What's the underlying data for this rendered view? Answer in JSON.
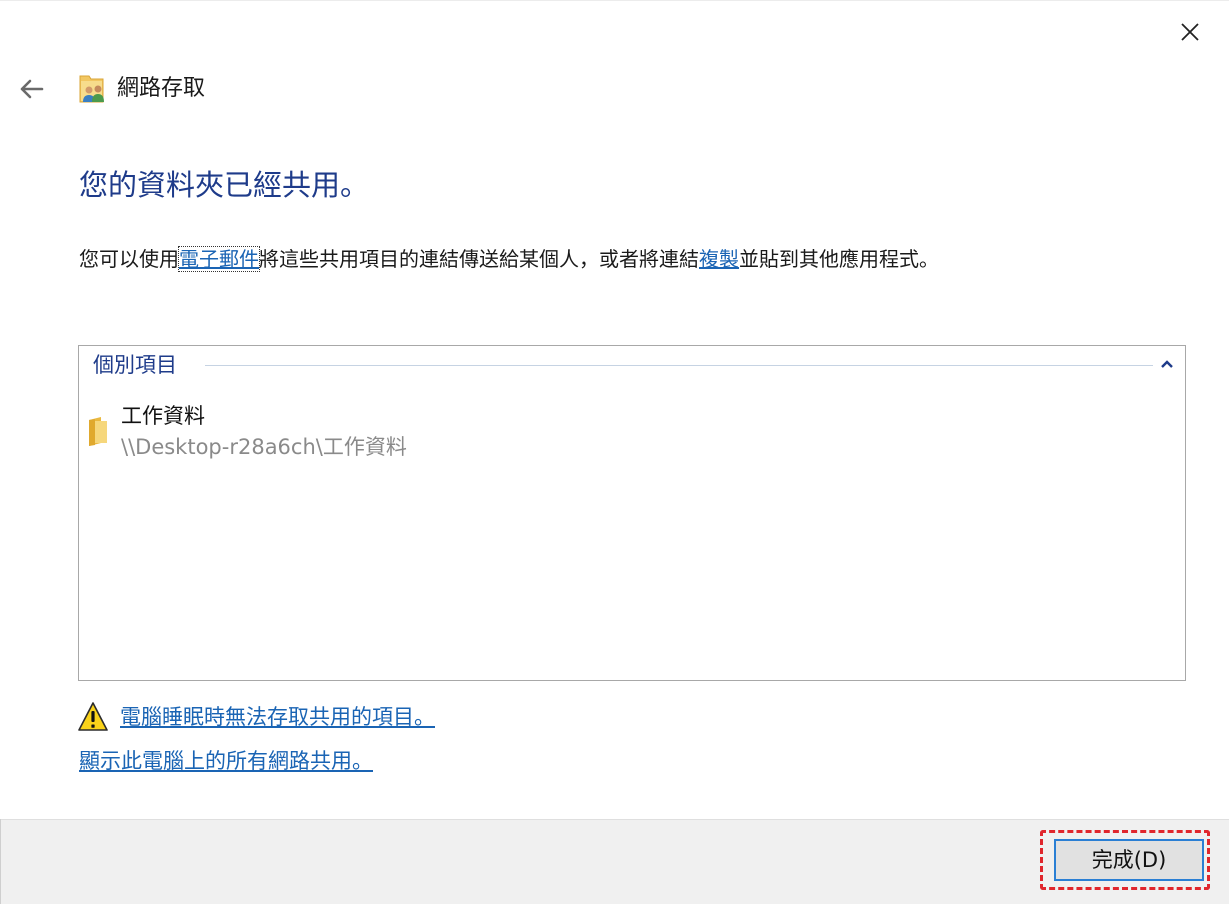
{
  "window": {
    "title": "網路存取",
    "icon": "network-share-users-icon"
  },
  "main": {
    "heading": "您的資料夾已經共用。",
    "description": {
      "before": "您可以使用",
      "email_link": "電子郵件",
      "middle": "將這些共用項目的連結傳送給某個人，或者將連結",
      "copy_link": "複製",
      "after": "並貼到其他應用程式。"
    }
  },
  "items_panel": {
    "group_label": "個別項目",
    "items": [
      {
        "name": "工作資料",
        "path": "\\\\Desktop-r28a6ch\\工作資料",
        "icon": "folder-icon"
      }
    ]
  },
  "links": {
    "sleep_warning": "電腦睡眠時無法存取共用的項目。",
    "show_all_shares": "顯示此電腦上的所有網路共用。"
  },
  "footer": {
    "finish_label": "完成(D)"
  },
  "colors": {
    "heading": "#1e3b8a",
    "link": "#1a64b4",
    "highlight": "#e0262d",
    "button_border": "#2a7fd4"
  }
}
